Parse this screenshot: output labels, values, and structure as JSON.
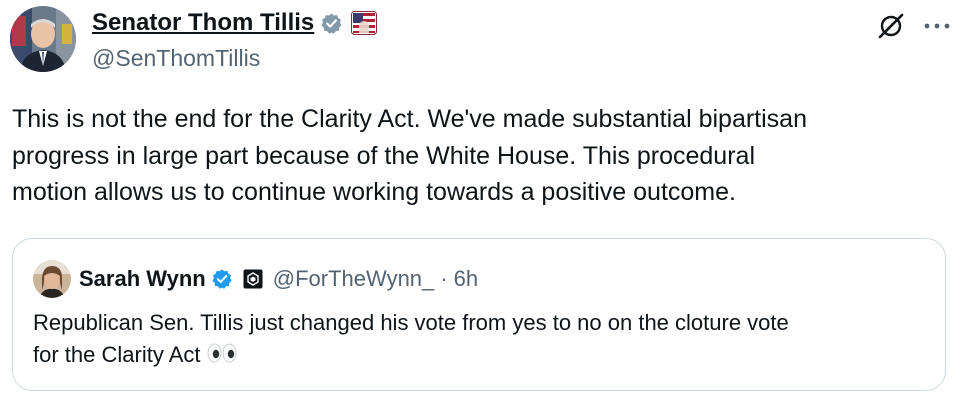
{
  "tweet": {
    "author": {
      "display_name": "Senator Thom Tillis",
      "handle": "@SenThomTillis",
      "verified_color": "#829aab",
      "avatar_icon": "portrait-photo"
    },
    "actions": {
      "grok_icon": "grok-icon",
      "more_icon": "more-dots-icon"
    },
    "text_lines": [
      "This is not the end for the Clarity Act. We've made substantial bipartisan",
      "progress in large part because of the White House. This procedural",
      "motion allows us to continue working towards a positive outcome."
    ]
  },
  "quote": {
    "display_name": "Sarah Wynn",
    "handle": "@ForTheWynn_",
    "separator": "·",
    "time": "6h",
    "verified_color": "#1d9bf0",
    "affiliate_icon": "affiliate-badge-icon",
    "text_lines": [
      "Republican Sen. Tillis just changed his vote from yes to no on the cloture vote",
      "for the Clarity Act"
    ],
    "emoji_icon": "eyes-emoji-icon"
  },
  "colors": {
    "text": "#0f1419",
    "secondary": "#536471",
    "border": "#cfd9de"
  }
}
